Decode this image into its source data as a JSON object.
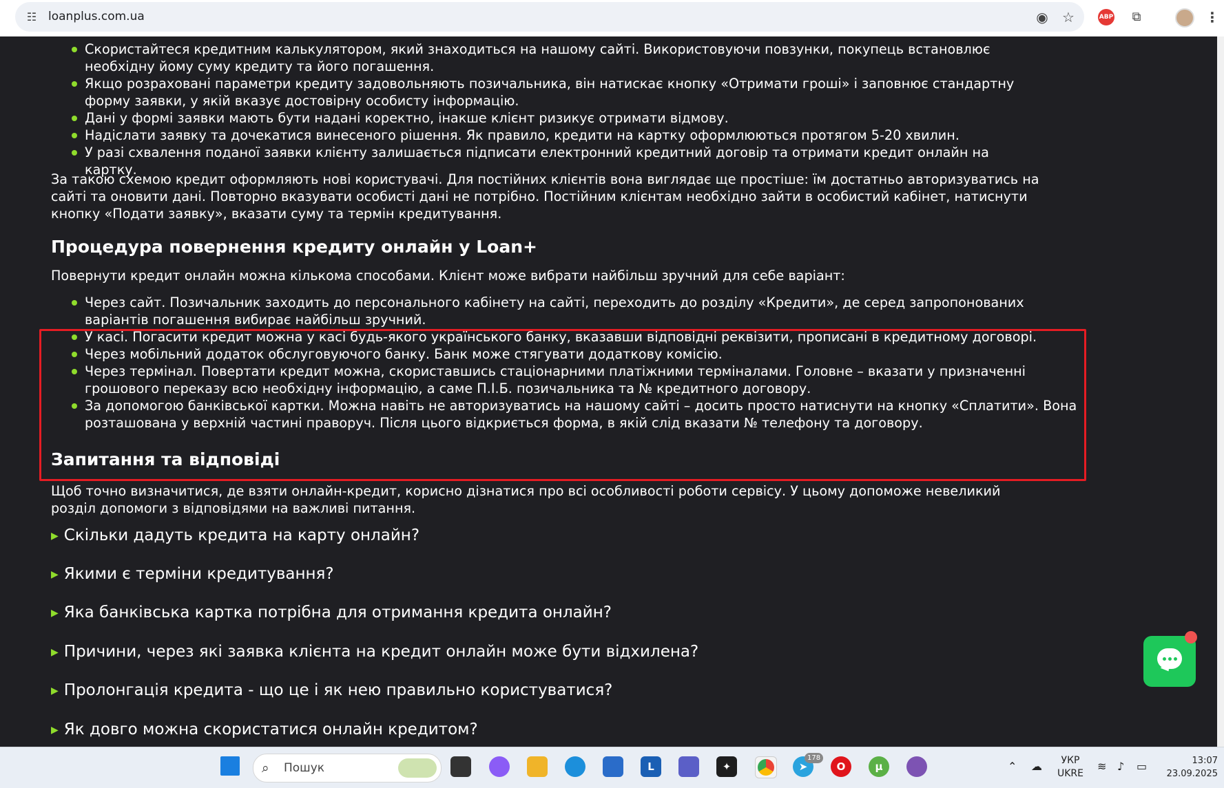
{
  "browser": {
    "url": "loanplus.com.ua",
    "abp_label": "ABP"
  },
  "content": {
    "list1": [
      "Скористайтеся кредитним калькулятором, який знаходиться на нашому сайті. Використовуючи повзунки, покупець встановлює необхідну йому суму кредиту та його погашення.",
      "Якщо розраховані параметри кредиту задовольняють позичальника, він натискає кнопку «Отримати гроші» і заповнює стандартну форму заявки, у якій вказує достовірну особисту інформацію.",
      "Дані у формі заявки мають бути надані коректно, інакше клієнт ризикує отримати відмову.",
      "Надіслати заявку та дочекатися винесеного рішення. Як правило, кредити на картку оформлюються протягом 5-20 хвилин.",
      "У разі схвалення поданої заявки клієнту залишається підписати електронний кредитний договір та отримати кредит онлайн на картку."
    ],
    "para1": "За такою схемою кредит оформляють нові користувачі. Для постійних клієнтів вона виглядає ще простіше: їм достатньо авторизуватись на сайті та оновити дані. Повторно вказувати особисті дані не потрібно. Постійним клієнтам необхідно зайти в особистий кабінет, натиснути кнопку «Подати заявку», вказати суму та термін кредитування.",
    "heading1": "Процедура повернення кредиту онлайн у Loan+",
    "para2": "Повернути кредит онлайн можна кількома способами. Клієнт може вибрати найбільш зручний для себе варіант:",
    "list2": [
      "Через сайт. Позичальник заходить до персонального кабінету на сайті, переходить до розділу «Кредити», де серед запропонованих варіантів погашення вибирає найбільш зручний.",
      "У касі. Погасити кредит можна у касі будь-якого українського банку, вказавши відповідні реквізити, прописані в кредитному договорі.",
      "Через мобільний додаток обслуговуючого банку. Банк може стягувати додаткову комісію.",
      "Через термінал. Повертати кредит можна, скориставшись стаціонарними платіжними терміналами. Головне – вказати у призначенні грошового переказу всю необхідну інформацію, а саме П.І.Б. позичальника та № кредитного договору.",
      "За допомогою банківської картки. Можна навіть не авторизуватись на нашому сайті – досить просто натиснути на кнопку «Сплатити». Вона розташована у верхній частині праворуч. Після цього відкриється форма, в якій слід вказати № телефону та договору."
    ],
    "heading2": "Запитання та відповіді",
    "para3": "Щоб точно визначитися, де взяти онлайн-кредит, корисно дізнатися про всі особливості роботи сервісу. У цьому допоможе невеликий розділ допомоги з відповідями на важливі питання.",
    "faq": [
      "Скільки дадуть кредита на карту онлайн?",
      "Якими є терміни кредитування?",
      "Яка банківська картка потрібна для отримання кредита онлайн?",
      "Причини, через які заявка клієнта на кредит онлайн може бути відхилена?",
      "Пролонгація кредита - що це і як нею правильно користуватися?",
      "Як довго можна скористатися онлайн кредитом?"
    ]
  },
  "taskbar": {
    "search_placeholder": "Пошук",
    "telegram_badge": "178",
    "lang_top": "УКР",
    "lang_bottom": "UKRE",
    "time": "13:07",
    "date": "23.09.2025"
  },
  "colors": {
    "page_bg": "#1f1f23",
    "bullet": "#8fdc2c",
    "highlight": "#e51c23",
    "chat": "#1ec85a"
  }
}
